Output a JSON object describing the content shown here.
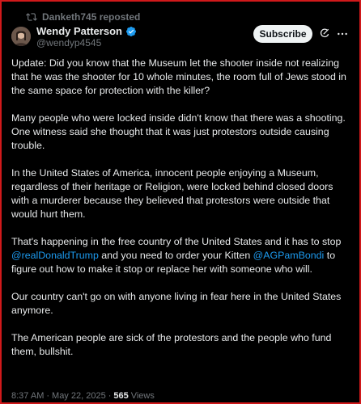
{
  "repost": {
    "label": "Danketh745 reposted"
  },
  "author": {
    "name": "Wendy Patterson",
    "handle": "@wendyp4545"
  },
  "actions": {
    "subscribe_label": "Subscribe"
  },
  "post": {
    "p1": "Update:  Did you know that the Museum let the shooter inside not realizing that he was the shooter for 10 whole minutes, the room full of Jews stood in the same space for protection with the killer?",
    "p2": "Many people who were locked inside didn't know that there was a shooting. One witness said she thought that it was just protestors outside causing trouble.",
    "p3": "In the United States of America, innocent people enjoying a Museum, regardless of their heritage or Religion, were locked behind closed doors with a murderer because they believed that protestors were outside that would hurt them.",
    "p4_a": "That's happening in the free country of the United States and it has to stop ",
    "p4_mention1": "@realDonaldTrump",
    "p4_b": " and you need to order your Kitten ",
    "p4_mention2": "@AGPamBondi",
    "p4_c": " to figure out how to make it stop or replace her with someone who will.",
    "p5": "Our country can't go on with anyone living in fear here in the United States anymore.",
    "p6": "The American people are sick of the protestors and the people who fund them, bullshit."
  },
  "meta": {
    "time": "8:37 AM",
    "sep1": "·",
    "date": "May 22, 2025",
    "sep2": "·",
    "views_count": "565",
    "views_label": "Views"
  },
  "colors": {
    "accent": "#1d9bf0",
    "border": "#d0191b",
    "background": "#000000"
  },
  "icons": [
    "repost-icon",
    "verified-icon",
    "grok-icon",
    "more-icon"
  ]
}
